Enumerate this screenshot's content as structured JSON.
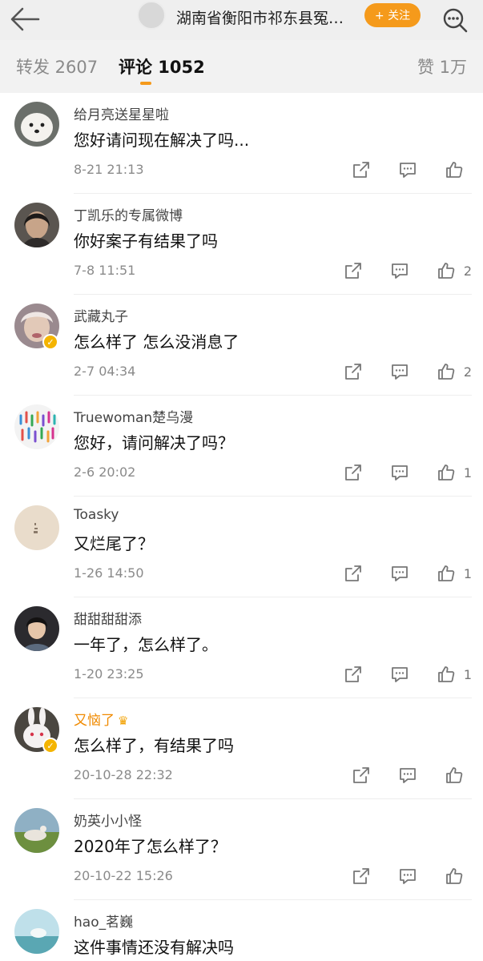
{
  "header": {
    "title": "湖南省衡阳市祁东县冤…",
    "follow_label": "+ 关注"
  },
  "tabs": [
    {
      "label": "转发 2607"
    },
    {
      "label": "评论 1052"
    },
    {
      "label": "赞 1万"
    }
  ],
  "comments": [
    {
      "user": "给月亮送星星啦",
      "text": "您好请问现在解决了吗...",
      "time": "8-21 21:13",
      "likes": ""
    },
    {
      "user": "丁凯乐的专属微博",
      "text": "你好案子有结果了吗",
      "time": "7-8 11:51",
      "likes": "2"
    },
    {
      "user": "武藏丸子",
      "text": "怎么样了 怎么没消息了",
      "time": "2-7 04:34",
      "likes": "2"
    },
    {
      "user": "Truewoman楚乌漫",
      "text": "您好，请问解决了吗？",
      "time": "2-6 20:02",
      "likes": "1"
    },
    {
      "user": "Toasky",
      "text": "又烂尾了？",
      "time": "1-26 14:50",
      "likes": "1"
    },
    {
      "user": "甜甜甜甜添",
      "text": "一年了，怎么样了。",
      "time": "1-20 23:25",
      "likes": "1"
    },
    {
      "user": "又恼了",
      "text": "怎么样了，有结果了吗",
      "time": "20-10-28 22:32",
      "likes": ""
    },
    {
      "user": "奶英小小怪",
      "text": "2020年了怎么样了？",
      "time": "20-10-22 15:26",
      "likes": ""
    },
    {
      "user": "hao_茗巍",
      "text": "这件事情还没有解决吗",
      "time": "",
      "likes": ""
    }
  ],
  "colors": {
    "accent": "#f59a1b",
    "verified": "#f4b400",
    "vip_name": "#f08a00"
  }
}
